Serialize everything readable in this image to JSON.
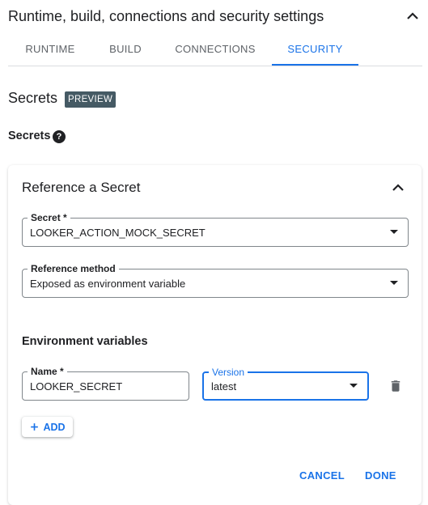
{
  "header": {
    "title": "Runtime, build, connections and security settings"
  },
  "tabs": [
    {
      "label": "RUNTIME"
    },
    {
      "label": "BUILD"
    },
    {
      "label": "CONNECTIONS"
    },
    {
      "label": "SECURITY"
    }
  ],
  "active_tab": "SECURITY",
  "section": {
    "title": "Secrets",
    "badge": "PREVIEW",
    "subtitle": "Secrets",
    "help_icon": "?"
  },
  "card": {
    "title": "Reference a Secret",
    "secret_field": {
      "label": "Secret *",
      "value": "LOOKER_ACTION_MOCK_SECRET"
    },
    "method_field": {
      "label": "Reference method",
      "value": "Exposed as environment variable"
    },
    "env_title": "Environment variables",
    "name_field": {
      "label": "Name *",
      "value": "LOOKER_SECRET"
    },
    "version_field": {
      "label": "Version",
      "value": "latest"
    },
    "add_label": "ADD",
    "cancel_label": "CANCEL",
    "done_label": "DONE"
  },
  "colors": {
    "accent": "#1a73e8",
    "badge_bg": "#455a64",
    "text": "#202124"
  }
}
